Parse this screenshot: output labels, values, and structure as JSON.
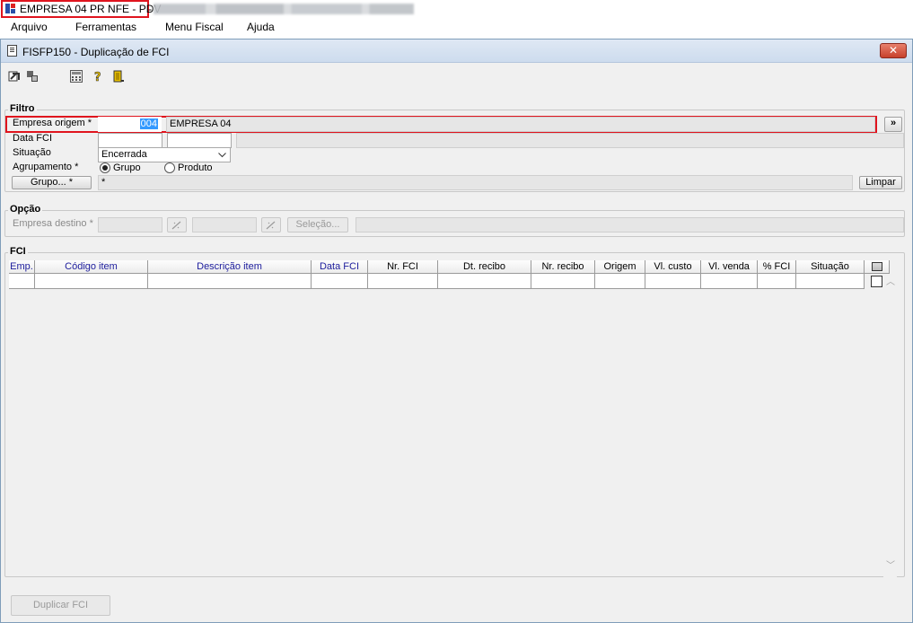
{
  "app": {
    "title": "EMPRESA 04 PR NFE - PDV",
    "title_suffix_blurred": "-"
  },
  "menu": {
    "items": [
      {
        "label": "Arquivo"
      },
      {
        "label": "Ferramentas"
      },
      {
        "label": "Menu Fiscal"
      },
      {
        "label": "Ajuda"
      }
    ]
  },
  "window": {
    "title": "FISFP150 - Duplicação de FCI",
    "close_glyph": "✕"
  },
  "toolbar": {
    "icons": [
      "exit-icon",
      "refresh-icon",
      "calculator-icon",
      "help-icon",
      "door-icon"
    ]
  },
  "filtro": {
    "group_label": "Filtro",
    "empresa_origem_label": "Empresa origem *",
    "empresa_origem_code": "004",
    "empresa_origem_name": "EMPRESA 04",
    "lookup_button": "»",
    "data_fci_label": "Data FCI",
    "situacao_label": "Situação",
    "situacao_value": "Encerrada",
    "agrupamento_label": "Agrupamento *",
    "radio_grupo": "Grupo",
    "radio_produto": "Produto",
    "grupo_button": "Grupo... *",
    "grupo_value": "*",
    "limpar_button": "Limpar"
  },
  "opcao": {
    "group_label": "Opção",
    "empresa_destino_label": "Empresa destino *",
    "selecao_button": "Seleção..."
  },
  "fci": {
    "group_label": "FCI",
    "columns": [
      "Emp.",
      "Código item",
      "Descrição item",
      "Data FCI",
      "Nr. FCI",
      "Dt. recibo",
      "Nr. recibo",
      "Origem",
      "Vl. custo",
      "Vl. venda",
      "% FCI",
      "Situação"
    ]
  },
  "footer": {
    "duplicar_button": "Duplicar FCI"
  },
  "colors": {
    "highlight": "#e0141e",
    "header_text": "#1c1c9c",
    "selection": "#3399ff"
  }
}
